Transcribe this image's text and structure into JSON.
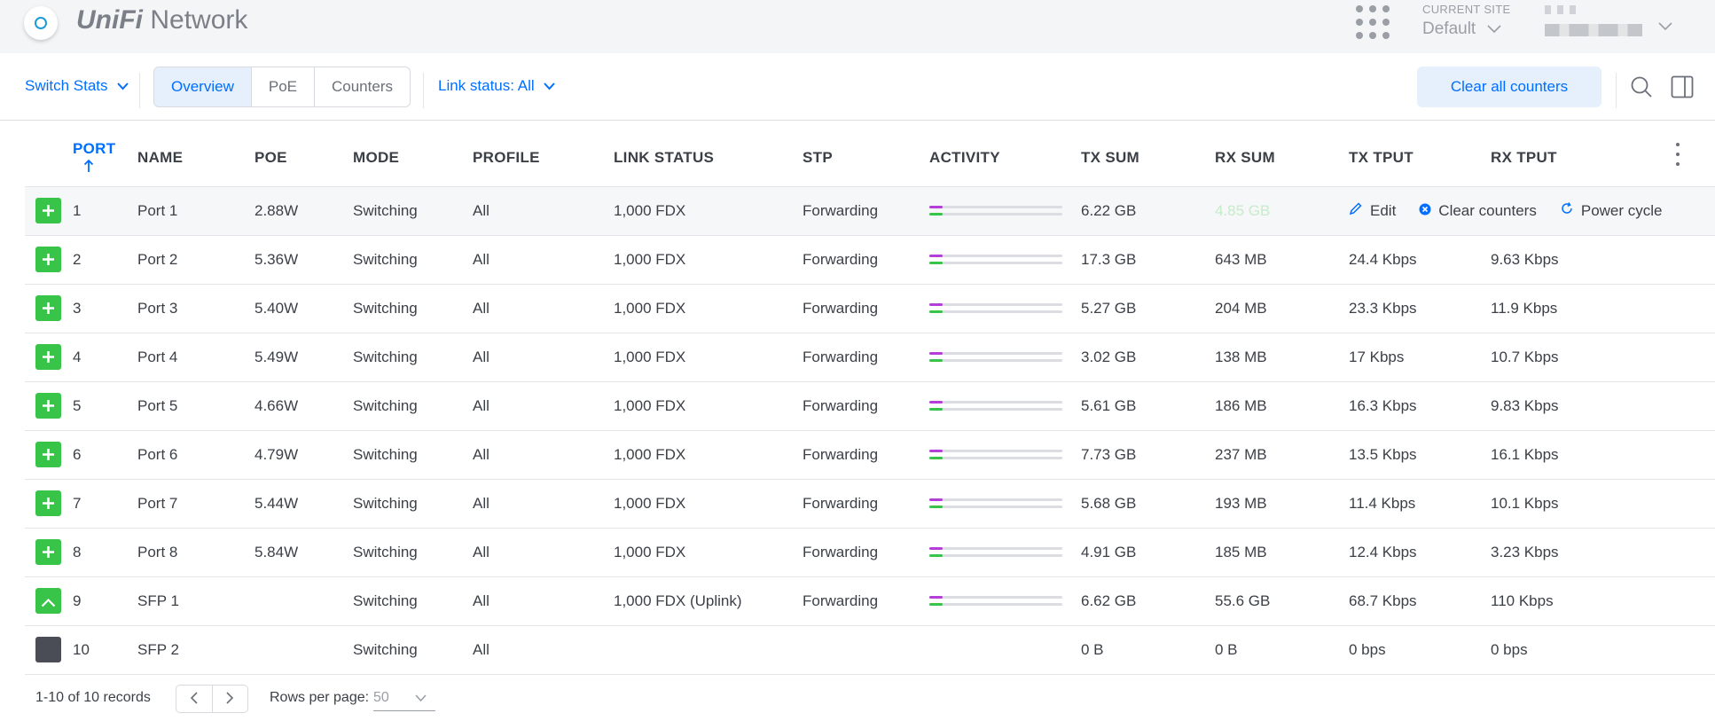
{
  "header": {
    "brand_part1": "UniFi",
    "brand_part2": "Network",
    "site_label": "CURRENT SITE",
    "site_value": "Default"
  },
  "toolbar": {
    "view_select": "Switch Stats",
    "tabs": [
      "Overview",
      "PoE",
      "Counters"
    ],
    "active_tab": "Overview",
    "link_status": "Link status: All",
    "clear_all": "Clear all counters"
  },
  "table": {
    "columns": [
      "PORT",
      "NAME",
      "POE",
      "MODE",
      "PROFILE",
      "LINK STATUS",
      "STP",
      "ACTIVITY",
      "TX SUM",
      "RX SUM",
      "TX TPUT",
      "RX TPUT"
    ],
    "sort_column": "PORT",
    "rows": [
      {
        "port": "1",
        "icon": "plus",
        "name": "Port 1",
        "poe": "2.88W",
        "mode": "Switching",
        "profile": "All",
        "link": "1,000 FDX",
        "stp": "Forwarding",
        "tx_act": 0.1,
        "rx_act": 0.1,
        "tx_sum": "6.22 GB",
        "rx_sum": "4.85 GB",
        "tx_tput": "",
        "rx_tput": ""
      },
      {
        "port": "2",
        "icon": "plus",
        "name": "Port 2",
        "poe": "5.36W",
        "mode": "Switching",
        "profile": "All",
        "link": "1,000 FDX",
        "stp": "Forwarding",
        "tx_act": 0.1,
        "rx_act": 0.1,
        "tx_sum": "17.3 GB",
        "rx_sum": "643 MB",
        "tx_tput": "24.4 Kbps",
        "rx_tput": "9.63 Kbps"
      },
      {
        "port": "3",
        "icon": "plus",
        "name": "Port 3",
        "poe": "5.40W",
        "mode": "Switching",
        "profile": "All",
        "link": "1,000 FDX",
        "stp": "Forwarding",
        "tx_act": 0.1,
        "rx_act": 0.1,
        "tx_sum": "5.27 GB",
        "rx_sum": "204 MB",
        "tx_tput": "23.3 Kbps",
        "rx_tput": "11.9 Kbps"
      },
      {
        "port": "4",
        "icon": "plus",
        "name": "Port 4",
        "poe": "5.49W",
        "mode": "Switching",
        "profile": "All",
        "link": "1,000 FDX",
        "stp": "Forwarding",
        "tx_act": 0.1,
        "rx_act": 0.1,
        "tx_sum": "3.02 GB",
        "rx_sum": "138 MB",
        "tx_tput": "17 Kbps",
        "rx_tput": "10.7 Kbps"
      },
      {
        "port": "5",
        "icon": "plus",
        "name": "Port 5",
        "poe": "4.66W",
        "mode": "Switching",
        "profile": "All",
        "link": "1,000 FDX",
        "stp": "Forwarding",
        "tx_act": 0.1,
        "rx_act": 0.1,
        "tx_sum": "5.61 GB",
        "rx_sum": "186 MB",
        "tx_tput": "16.3 Kbps",
        "rx_tput": "9.83 Kbps"
      },
      {
        "port": "6",
        "icon": "plus",
        "name": "Port 6",
        "poe": "4.79W",
        "mode": "Switching",
        "profile": "All",
        "link": "1,000 FDX",
        "stp": "Forwarding",
        "tx_act": 0.1,
        "rx_act": 0.1,
        "tx_sum": "7.73 GB",
        "rx_sum": "237 MB",
        "tx_tput": "13.5 Kbps",
        "rx_tput": "16.1 Kbps"
      },
      {
        "port": "7",
        "icon": "plus",
        "name": "Port 7",
        "poe": "5.44W",
        "mode": "Switching",
        "profile": "All",
        "link": "1,000 FDX",
        "stp": "Forwarding",
        "tx_act": 0.1,
        "rx_act": 0.1,
        "tx_sum": "5.68 GB",
        "rx_sum": "193 MB",
        "tx_tput": "11.4 Kbps",
        "rx_tput": "10.1 Kbps"
      },
      {
        "port": "8",
        "icon": "plus",
        "name": "Port 8",
        "poe": "5.84W",
        "mode": "Switching",
        "profile": "All",
        "link": "1,000 FDX",
        "stp": "Forwarding",
        "tx_act": 0.1,
        "rx_act": 0.1,
        "tx_sum": "4.91 GB",
        "rx_sum": "185 MB",
        "tx_tput": "12.4 Kbps",
        "rx_tput": "3.23 Kbps"
      },
      {
        "port": "9",
        "icon": "uplink",
        "name": "SFP 1",
        "poe": "",
        "mode": "Switching",
        "profile": "All",
        "link": "1,000 FDX (Uplink)",
        "stp": "Forwarding",
        "tx_act": 0.1,
        "rx_act": 0.1,
        "tx_sum": "6.62 GB",
        "rx_sum": "55.6 GB",
        "tx_tput": "68.7 Kbps",
        "rx_tput": "110 Kbps"
      },
      {
        "port": "10",
        "icon": "empty",
        "name": "SFP 2",
        "poe": "",
        "mode": "Switching",
        "profile": "All",
        "link": "",
        "stp": "",
        "tx_act": null,
        "rx_act": null,
        "tx_sum": "0 B",
        "rx_sum": "0 B",
        "tx_tput": "0 bps",
        "rx_tput": "0 bps"
      }
    ],
    "row_actions": {
      "edit": "Edit",
      "clear": "Clear counters",
      "power": "Power cycle"
    }
  },
  "pager": {
    "count": "1-10 of 10 records",
    "rows_per_page_label": "Rows per page:",
    "rows_per_page_value": "50"
  },
  "colors": {
    "accent": "#006fff",
    "tx": "#b13fd8",
    "rx": "#37c449",
    "port_up": "#37c449",
    "port_down": "#4a4d55"
  }
}
